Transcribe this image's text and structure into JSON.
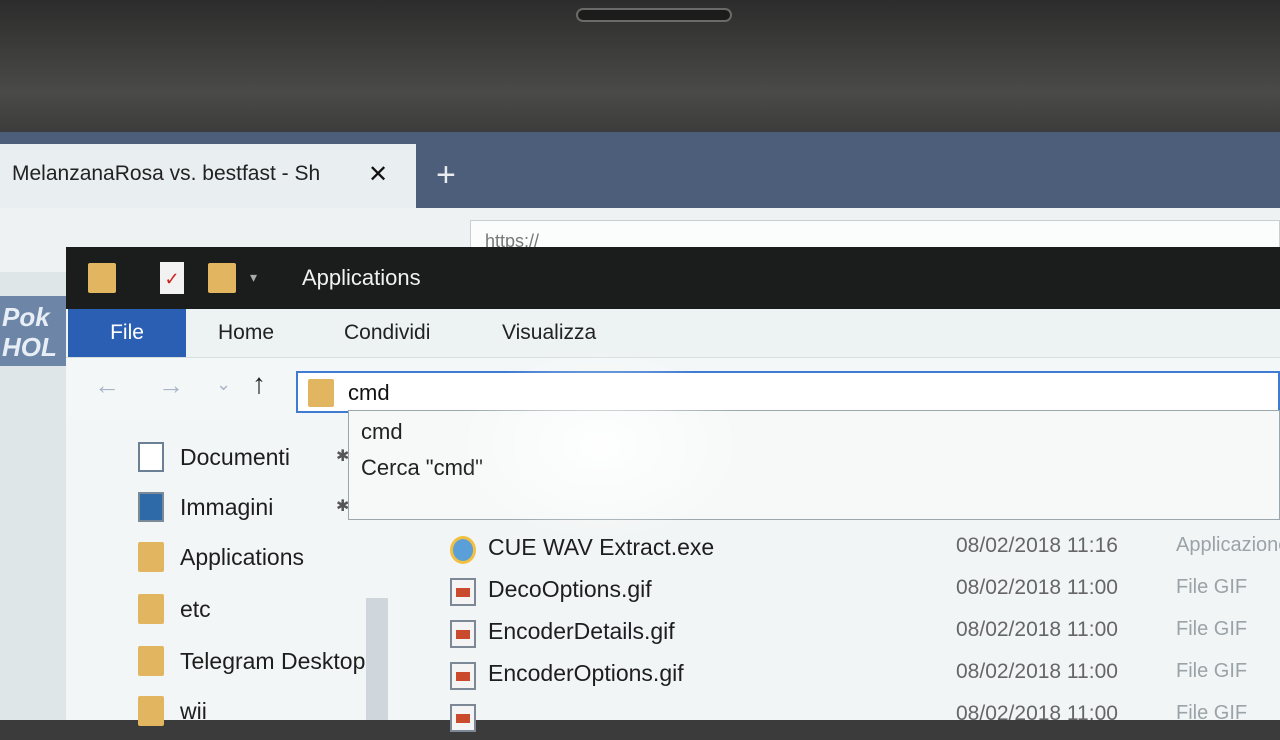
{
  "browser": {
    "tab_title": "MelanzanaRosa vs. bestfast - Sh",
    "close_glyph": "✕",
    "new_tab_glyph": "+",
    "url": "https://",
    "logo_text": "Pok HOL"
  },
  "explorer": {
    "window_title": "Applications",
    "ribbon": {
      "tabs": [
        "File",
        "Home",
        "Condividi",
        "Visualizza"
      ]
    },
    "nav": {
      "back": "←",
      "forward": "→",
      "recent": "⌄",
      "up": "↑"
    },
    "address": {
      "value": "cmd"
    },
    "suggestions": [
      "cmd",
      "Cerca \"cmd\""
    ],
    "navpane": [
      {
        "label": "Documenti",
        "icon": "document-icon",
        "pinned": true
      },
      {
        "label": "Immagini",
        "icon": "pictures-icon",
        "pinned": true
      },
      {
        "label": "Applications",
        "icon": "folder-icon",
        "pinned": false
      },
      {
        "label": "etc",
        "icon": "folder-icon",
        "pinned": false
      },
      {
        "label": "Telegram Desktop",
        "icon": "folder-icon",
        "pinned": false
      },
      {
        "label": "wii",
        "icon": "folder-icon",
        "pinned": false
      }
    ],
    "pin_glyph": "✱",
    "files": [
      {
        "name": "CUE WAV Extract.exe",
        "date": "08/02/2018 11:16",
        "type": "Applicazione",
        "icon": "exe"
      },
      {
        "name": "DecoOptions.gif",
        "date": "08/02/2018 11:00",
        "type": "File GIF",
        "icon": "gif"
      },
      {
        "name": "EncoderDetails.gif",
        "date": "08/02/2018 11:00",
        "type": "File GIF",
        "icon": "gif"
      },
      {
        "name": "EncoderOptions.gif",
        "date": "08/02/2018 11:00",
        "type": "File GIF",
        "icon": "gif"
      },
      {
        "name": "",
        "date": "08/02/2018 11:00",
        "type": "File GIF",
        "icon": "gif"
      }
    ]
  }
}
